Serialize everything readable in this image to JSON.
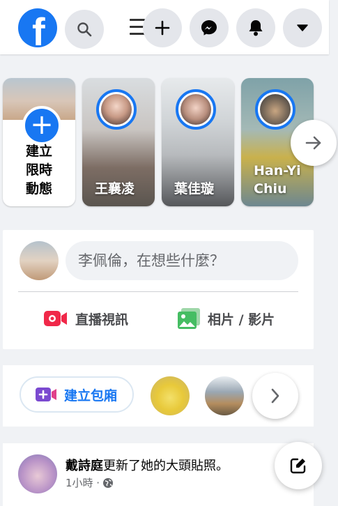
{
  "header": {
    "logo_letter": "f",
    "icons": [
      "search-icon",
      "menu-icon",
      "plus-icon",
      "messenger-icon",
      "bell-icon",
      "caret-down-icon"
    ]
  },
  "stories": {
    "create_label": "建立\n限時\n動態",
    "items": [
      {
        "name": "王襄凌"
      },
      {
        "name": "葉佳璇"
      },
      {
        "name": "Han-Yi Chiu"
      }
    ]
  },
  "composer": {
    "placeholder": "李佩倫，在想些什麼？",
    "live_label": "直播視訊",
    "photo_label": "相片 / 影片"
  },
  "rooms": {
    "create_label": "建立包廂"
  },
  "post": {
    "author": "戴詩庭",
    "action": "更新了她的大頭貼照。",
    "time": "1小時 ·"
  },
  "colors": {
    "brand": "#1877f2",
    "live_red": "#f02849",
    "photo_green": "#45bd62",
    "room_purple": "#7b4ad0"
  }
}
